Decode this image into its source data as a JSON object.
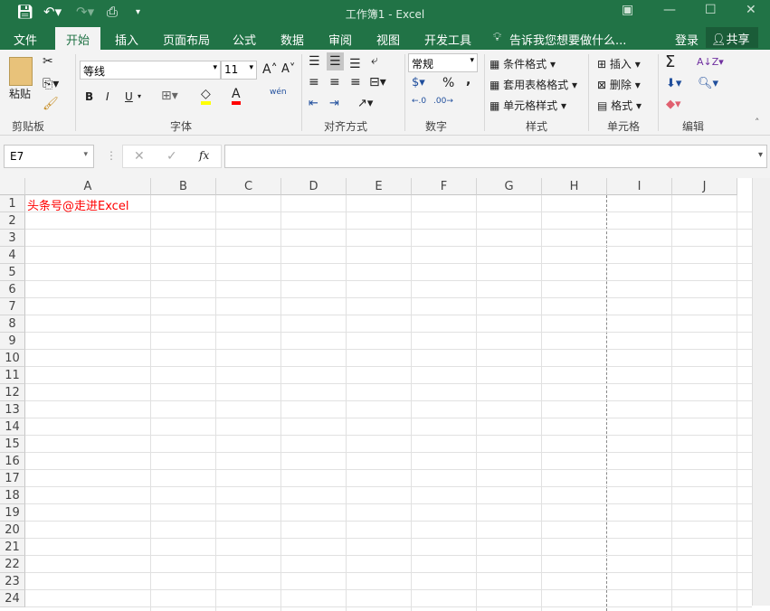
{
  "window": {
    "title": "工作簿1 - Excel"
  },
  "tabs": [
    {
      "label": "文件"
    },
    {
      "label": "开始"
    },
    {
      "label": "插入"
    },
    {
      "label": "页面布局"
    },
    {
      "label": "公式"
    },
    {
      "label": "数据"
    },
    {
      "label": "审阅"
    },
    {
      "label": "视图"
    },
    {
      "label": "开发工具"
    }
  ],
  "tell_me": "告诉我您想要做什么...",
  "signin": "登录",
  "share": "共享",
  "ribbon": {
    "clipboard": {
      "paste": "粘贴",
      "label": "剪贴板"
    },
    "font": {
      "name": "等线",
      "size": "11",
      "bold": "B",
      "italic": "I",
      "underline": "U",
      "font_color": "A",
      "phonetic": "wén",
      "label": "字体"
    },
    "alignment": {
      "label": "对齐方式"
    },
    "number": {
      "format": "常规",
      "percent": "%",
      "comma": ",",
      "label": "数字"
    },
    "styles": {
      "conditional": "条件格式",
      "table": "套用表格格式",
      "cell": "单元格样式",
      "label": "样式"
    },
    "cells": {
      "insert": "插入",
      "delete": "删除",
      "format": "格式",
      "label": "单元格"
    },
    "editing": {
      "sum": "Σ",
      "label": "编辑"
    }
  },
  "formula_bar": {
    "name_box": "E7",
    "fx": "fx",
    "value": ""
  },
  "columns": [
    "A",
    "B",
    "C",
    "D",
    "E",
    "F",
    "G",
    "H",
    "I",
    "J"
  ],
  "rows": [
    "1",
    "2",
    "3",
    "4",
    "5",
    "6",
    "7",
    "8",
    "9",
    "10",
    "11",
    "12",
    "13",
    "14",
    "15",
    "16",
    "17",
    "18",
    "19",
    "20",
    "21",
    "22",
    "23",
    "24"
  ],
  "cells": {
    "A1": "头条号@走进Excel"
  },
  "colors": {
    "brand": "#217346",
    "cell_text": "#ff0000"
  }
}
